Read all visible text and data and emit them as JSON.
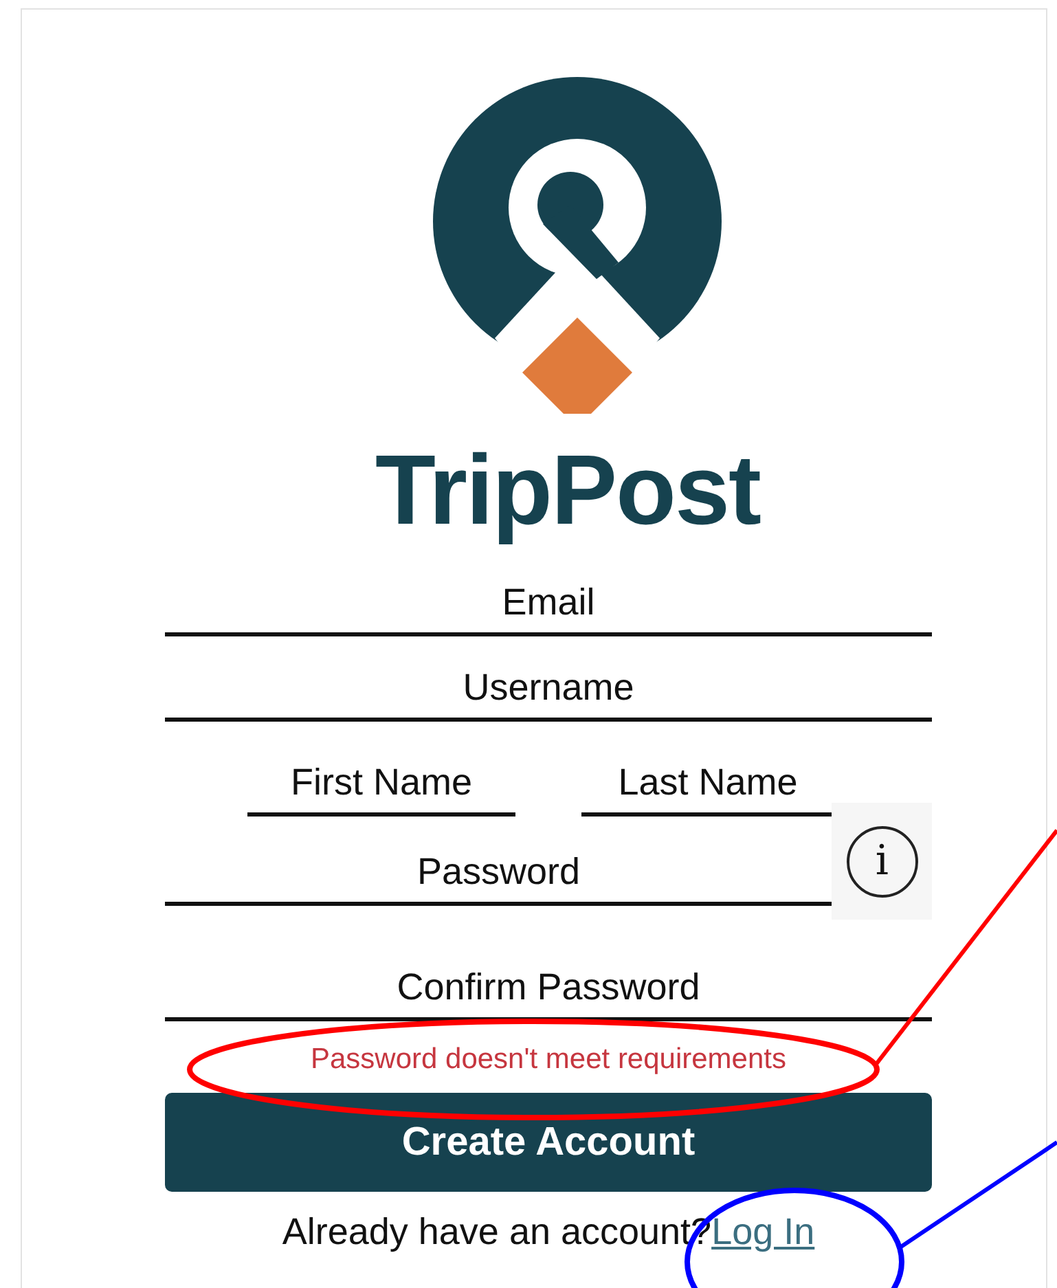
{
  "logo": {
    "name": "TripPost"
  },
  "form": {
    "rows": [
      [
        {
          "placeholder": "Email"
        }
      ],
      [
        {
          "placeholder": "Username"
        }
      ],
      [
        {
          "placeholder": "First Name"
        },
        {
          "placeholder": "Last Name"
        }
      ],
      [
        {
          "placeholder": "Password",
          "info_button": "i"
        }
      ],
      [
        {
          "placeholder": "Confirm Password"
        }
      ]
    ],
    "error": "Password doesn't meet requirements",
    "submit": "Create Account",
    "footer": {
      "text": "Already have an account?",
      "link": "Log In"
    }
  },
  "annotations": [
    {
      "color": "#ff0000"
    },
    {
      "color": "#0000ff"
    }
  ]
}
